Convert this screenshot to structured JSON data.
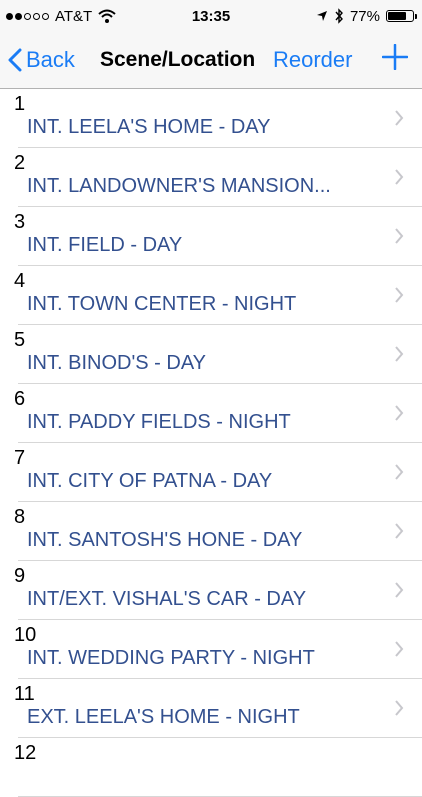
{
  "status_bar": {
    "carrier": "AT&T",
    "time": "13:35",
    "battery": "77%",
    "battery_level": 0.77
  },
  "navbar": {
    "back_label": "Back",
    "title": "Scene/Location",
    "reorder_label": "Reorder"
  },
  "scenes": [
    {
      "number": "1",
      "location": "INT. LEELA'S HOME - DAY"
    },
    {
      "number": "2",
      "location": "INT. LANDOWNER'S MANSION..."
    },
    {
      "number": "3",
      "location": "INT. FIELD  - DAY"
    },
    {
      "number": "4",
      "location": "INT. TOWN CENTER - NIGHT"
    },
    {
      "number": "5",
      "location": "INT. BINOD'S  - DAY"
    },
    {
      "number": "6",
      "location": "INT. PADDY FIELDS - NIGHT"
    },
    {
      "number": "7",
      "location": "INT. CITY OF PATNA - DAY"
    },
    {
      "number": "8",
      "location": "INT. SANTOSH'S HONE - DAY"
    },
    {
      "number": "9",
      "location": "INT/EXT. VISHAL'S CAR - DAY"
    },
    {
      "number": "10",
      "location": "INT. WEDDING PARTY - NIGHT"
    },
    {
      "number": "11",
      "location": "EXT. LEELA'S HOME - NIGHT"
    },
    {
      "number": "12",
      "location": ""
    }
  ],
  "colors": {
    "accent": "#1a7cf5",
    "location_text": "#33508f"
  }
}
